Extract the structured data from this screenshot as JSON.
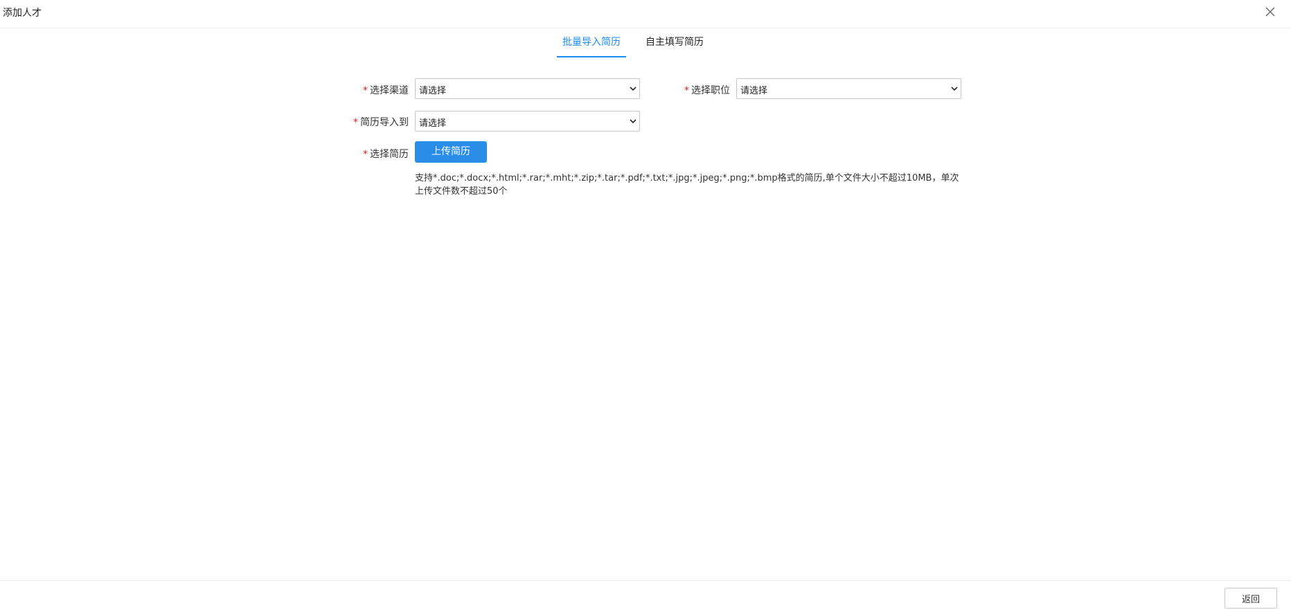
{
  "dialog": {
    "title": "添加人才",
    "close_icon": "close-icon"
  },
  "tabs": [
    {
      "label": "批量导入简历",
      "active": true
    },
    {
      "label": "自主填写简历",
      "active": false
    }
  ],
  "form": {
    "required_mark": "*",
    "channel": {
      "label": "选择渠道",
      "value": "请选择"
    },
    "position": {
      "label": "选择职位",
      "value": "请选择"
    },
    "import_to": {
      "label": "简历导入到",
      "value": "请选择"
    },
    "resume": {
      "label": "选择简历",
      "button_label": "上传简历"
    },
    "hint": "支持*.doc;*.docx;*.html;*.rar;*.mht;*.zip;*.tar;*.pdf;*.txt;*.jpg;*.jpeg;*.png;*.bmp格式的简历,单个文件大小不超过10MB，单次上传文件数不超过50个"
  },
  "footer": {
    "back_label": "返回"
  },
  "colors": {
    "accent": "#1a8cf0",
    "button": "#2a8ee8",
    "required": "#e02020"
  }
}
